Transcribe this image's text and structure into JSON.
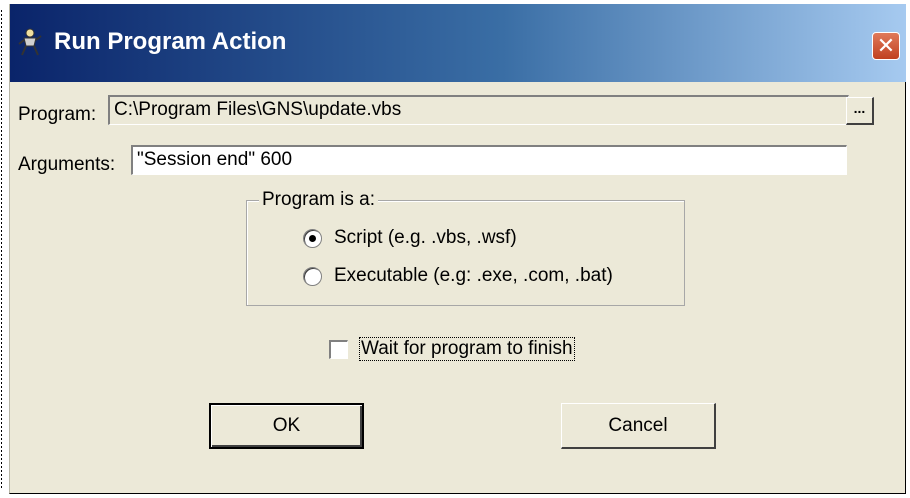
{
  "window": {
    "title": "Run Program Action",
    "close_label": "✕"
  },
  "program": {
    "label": "Program:",
    "value": "C:\\Program Files\\GNS\\update.vbs",
    "browse_label": "..."
  },
  "arguments": {
    "label": "Arguments:",
    "value": "\"Session end\" 600"
  },
  "program_type": {
    "group_title": "Program is a:",
    "options": [
      {
        "label": "Script (e.g. .vbs, .wsf)",
        "checked": true
      },
      {
        "label": "Executable (e.g: .exe, .com, .bat)",
        "checked": false
      }
    ]
  },
  "wait": {
    "label": "Wait for program to finish",
    "checked": false
  },
  "buttons": {
    "ok": "OK",
    "cancel": "Cancel"
  }
}
